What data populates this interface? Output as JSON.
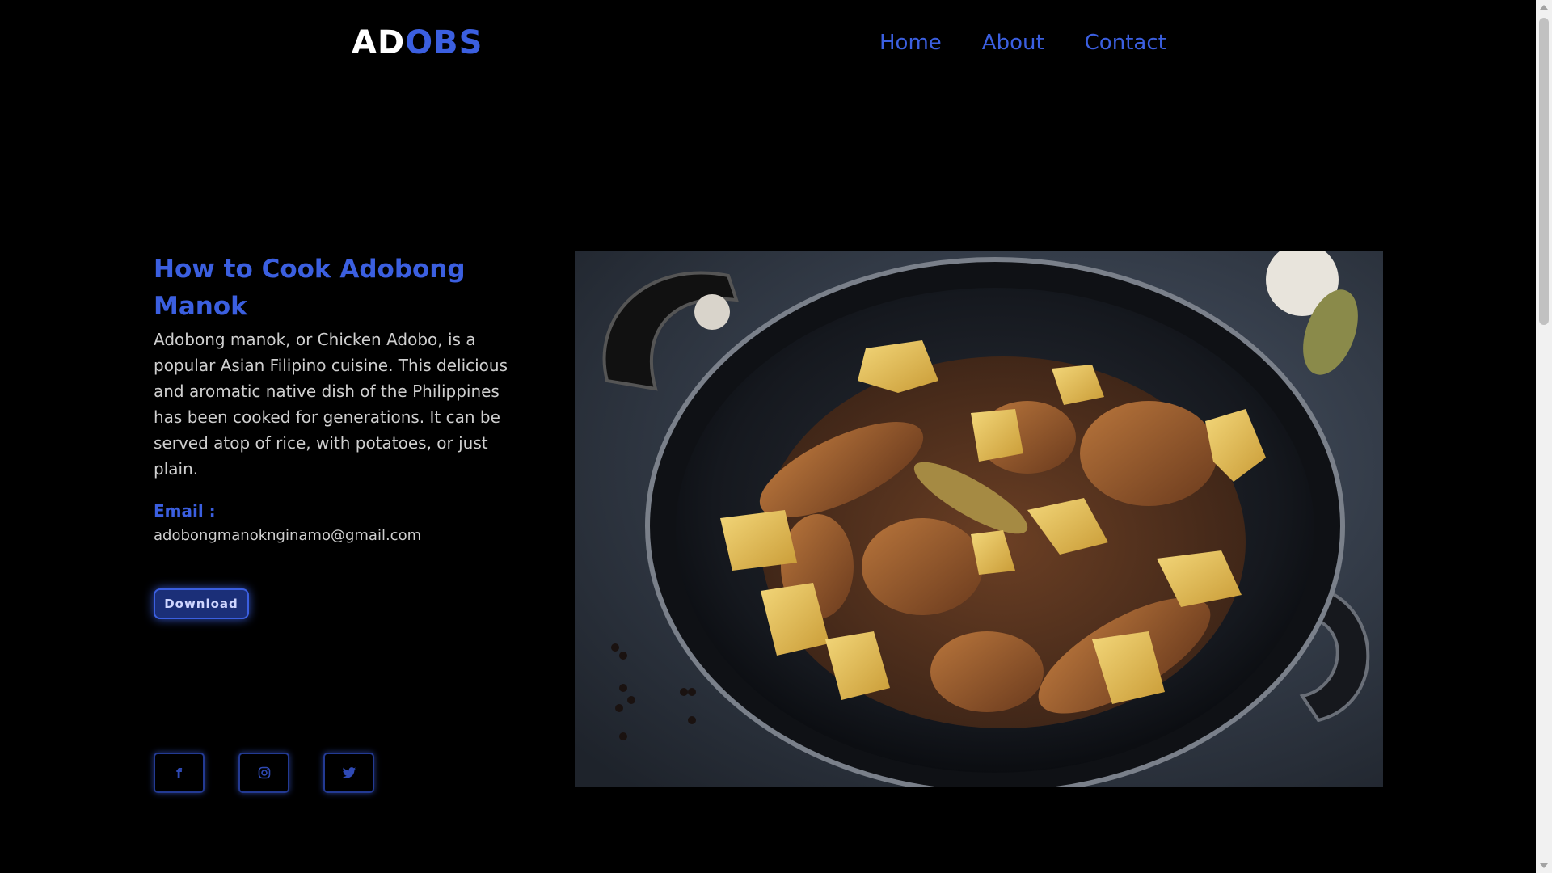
{
  "header": {
    "logo_part1": "AD",
    "logo_part2": "OBS",
    "nav": [
      "Home",
      "About",
      "Contact"
    ]
  },
  "main": {
    "title": "How to Cook Adobong Manok",
    "description": "Adobong manok, or Chicken Adobo, is a popular Asian Filipino cuisine. This delicious and aromatic native dish of the Philippines has been cooked for generations. It can be served atop of rice, with potatoes, or just plain.",
    "email_label": "Email :",
    "email": "adobongmanoknginamo@gmail.com",
    "download_label": "Download"
  },
  "social": [
    {
      "icon": "facebook-icon",
      "glyph": "f"
    },
    {
      "icon": "instagram-icon",
      "glyph": "◎"
    },
    {
      "icon": "twitter-icon",
      "glyph": "🐦"
    }
  ],
  "hero_image": {
    "subject": "chicken-adobo-with-potatoes-in-pan"
  },
  "colors": {
    "accent": "#3b5fe0",
    "background": "#000000",
    "text": "#cfcfcf",
    "button_bg": "#1b2f78"
  }
}
